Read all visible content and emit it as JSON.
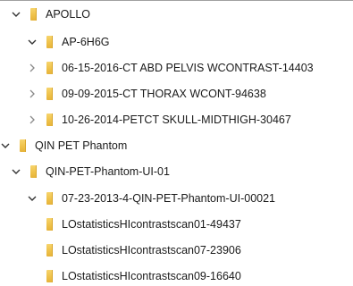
{
  "tree": {
    "items": [
      {
        "label": "APOLLO",
        "state": "expanded",
        "level": 1
      },
      {
        "label": "AP-6H6G",
        "state": "expanded",
        "level": 2
      },
      {
        "label": "06-15-2016-CT ABD  PELVIS WCONTRAST-14403",
        "state": "collapsed",
        "level": 3
      },
      {
        "label": "09-09-2015-CT THORAX WCONT-94638",
        "state": "collapsed",
        "level": 3
      },
      {
        "label": "10-26-2014-PETCT SKULL-MIDTHIGH-30467",
        "state": "collapsed",
        "level": 3
      },
      {
        "label": "QIN PET Phantom",
        "state": "expanded",
        "level": 0
      },
      {
        "label": "QIN-PET-Phantom-UI-01",
        "state": "expanded",
        "level": 1
      },
      {
        "label": "07-23-2013-4-QIN-PET-Phantom-UI-00021",
        "state": "expanded",
        "level": 2
      },
      {
        "label": "LOstatisticsHIcontrastscan01-49437",
        "state": "leaf",
        "level": 3
      },
      {
        "label": "LOstatisticsHIcontrastscan07-23906",
        "state": "leaf",
        "level": 3
      },
      {
        "label": "LOstatisticsHIcontrastscan09-16640",
        "state": "leaf",
        "level": 3
      }
    ]
  },
  "colors": {
    "folder": "#eec048",
    "chevron": "#333333",
    "text": "#1a1a1a"
  },
  "icons": {
    "expanded": "chevron-down-icon",
    "collapsed": "chevron-right-icon",
    "folder": "folder-icon"
  }
}
